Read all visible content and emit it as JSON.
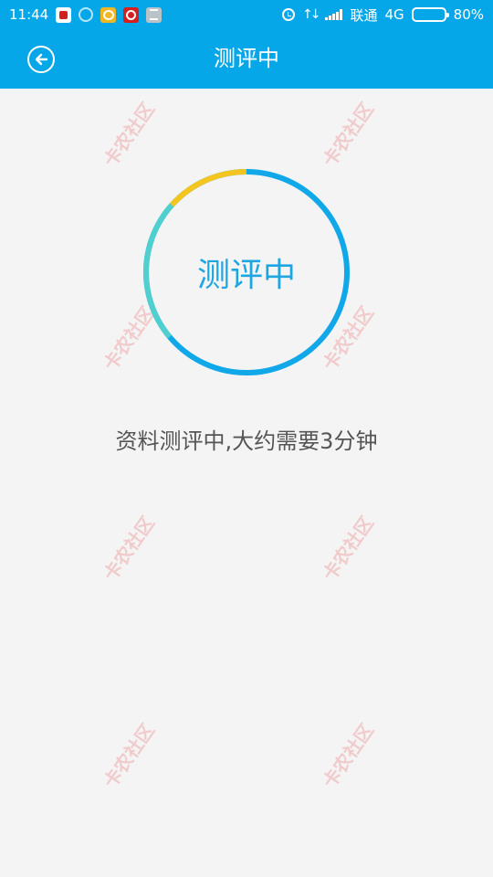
{
  "status_bar": {
    "time": "11:44",
    "carrier": "联通",
    "network": "4G",
    "battery_percent": "80%",
    "battery_level": 0.8,
    "notification_icons": [
      "game-icon",
      "settings-icon",
      "chat-icon",
      "news-icon",
      "message-icon"
    ]
  },
  "title_bar": {
    "title": "测评中",
    "back_icon": "back-arrow-icon"
  },
  "progress": {
    "label": "测评中",
    "colors": {
      "primary": "#10a8e8",
      "secondary": "#4fcfcd",
      "accent": "#f4c51f"
    }
  },
  "message": "资料测评中,大约需要3分钟",
  "theme": {
    "header_bg": "#05a7e8",
    "page_bg": "#f4f4f4",
    "text_color": "#555555"
  }
}
